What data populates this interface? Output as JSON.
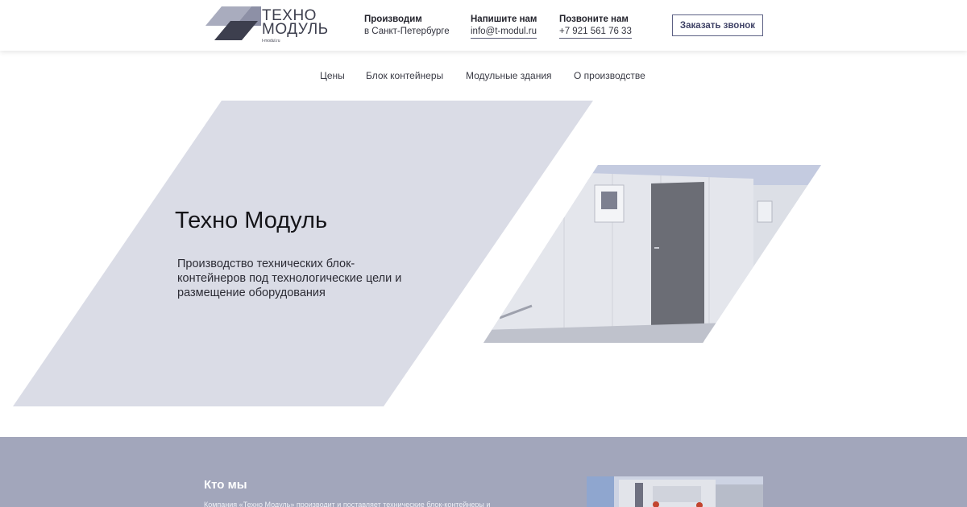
{
  "header": {
    "logo": {
      "line1": "ТЕХНО",
      "line2": "МОДУЛЬ",
      "domain": "t-modul.ru",
      "colors": {
        "dark": "#3d3f4e",
        "mid": "#6e7186",
        "light": "#a9acbe"
      }
    },
    "production": {
      "title": "Производим",
      "value": "в Санкт-Петербурге"
    },
    "email": {
      "title": "Напишите нам",
      "value": "info@t-modul.ru"
    },
    "phone": {
      "title": "Позвоните нам",
      "value": "+7 921 561 76 33"
    },
    "callback_button": "Заказать звонок"
  },
  "nav": {
    "items": [
      {
        "label": "Цены"
      },
      {
        "label": "Блок контейнеры"
      },
      {
        "label": "Модульные здания"
      },
      {
        "label": "О производстве"
      }
    ]
  },
  "hero": {
    "title": "Техно Модуль",
    "subtitle": "Производство технических блок-контейнеров под технологические цели и размещение оборудования",
    "shape_color": "#dadce6"
  },
  "about": {
    "title": "Кто мы",
    "text": "Компания «Техно Модуль» производит и поставляет технические блок-контейнеры и",
    "background": "#a2a6bb"
  }
}
